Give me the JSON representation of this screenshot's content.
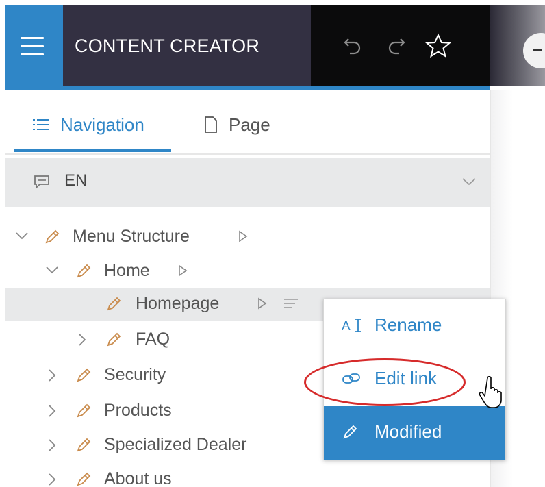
{
  "app": {
    "title": "CONTENT CREATOR"
  },
  "toolbar": {
    "undo_icon": "undo-icon",
    "redo_icon": "redo-icon",
    "favorite_icon": "star-icon"
  },
  "tabs": [
    {
      "label": "Navigation",
      "icon": "list-icon",
      "active": true
    },
    {
      "label": "Page",
      "icon": "page-icon",
      "active": false
    }
  ],
  "language": {
    "code": "EN",
    "icon": "comment-icon"
  },
  "tree": [
    {
      "label": "Menu Structure",
      "expanded": true
    },
    {
      "label": "Home",
      "expanded": true
    },
    {
      "label": "Homepage",
      "selected": true
    },
    {
      "label": "FAQ",
      "expanded": false
    },
    {
      "label": "Security",
      "expanded": false
    },
    {
      "label": "Products",
      "expanded": false
    },
    {
      "label": "Specialized Dealer",
      "expanded": false
    },
    {
      "label": "About us",
      "expanded": false
    }
  ],
  "context_menu": [
    {
      "label": "Rename",
      "icon": "rename-icon"
    },
    {
      "label": "Edit link",
      "icon": "link-icon"
    },
    {
      "label": "Modified",
      "icon": "pencil-icon",
      "highlighted": true
    }
  ],
  "colors": {
    "accent": "#2f86c7",
    "header_dark": "#333042",
    "toolbar_black": "#0b0b0c",
    "highlight_oval": "#d62b2b",
    "pencil": "#c98b4c"
  }
}
